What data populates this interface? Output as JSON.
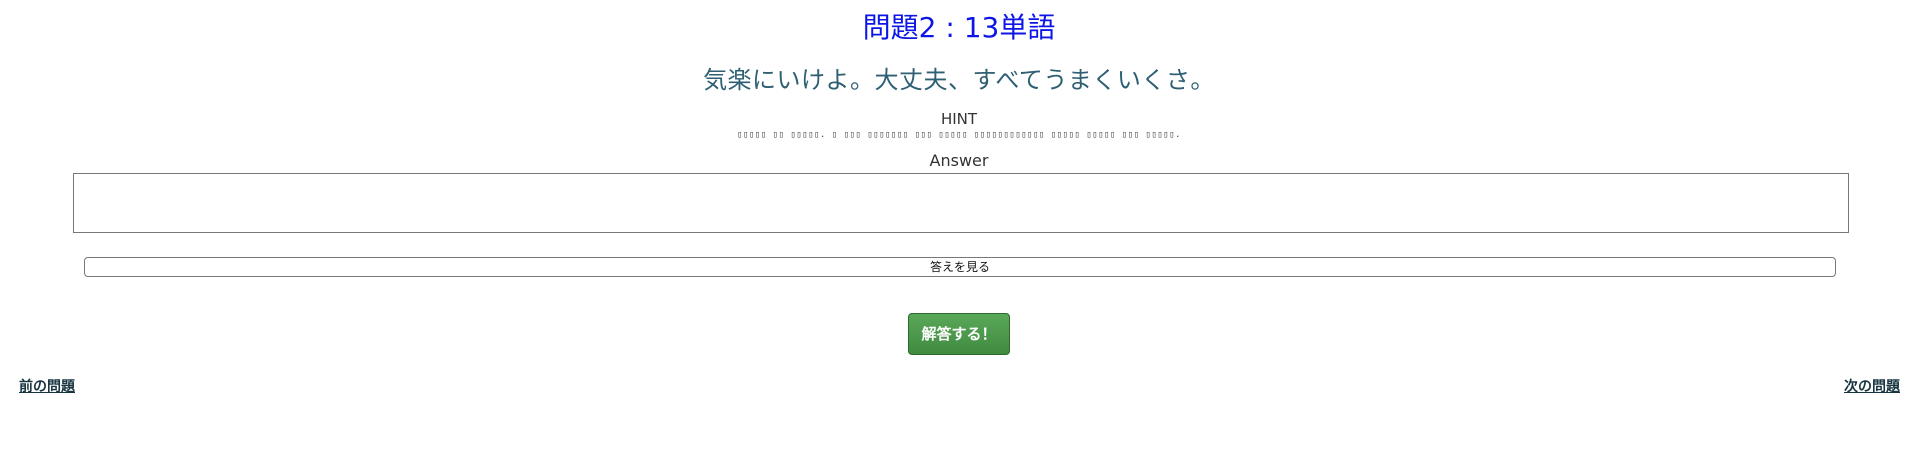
{
  "question": {
    "title": "問題2 : 13単語",
    "sentence": "気楽にいけよ。大丈夫、すべてうまくいくさ。",
    "hint_label": "HINT",
    "hint_text": "▯▯▯▯▯ ▯▯ ▯▯▯▯▯. ▯ ▯▯▯ ▯▯▯▯▯▯▯ ▯▯▯ ▯▯▯▯▯ ▯▯▯▯▯▯▯▯▯▯▯▯ ▯▯▯▯▯ ▯▯▯▯▯ ▯▯▯ ▯▯▯▯▯."
  },
  "answer": {
    "label": "Answer",
    "value": ""
  },
  "buttons": {
    "show_answer": "答えを見る",
    "submit": "解答する！"
  },
  "nav": {
    "prev": "前の問題",
    "next": "次の問題"
  },
  "colors": {
    "title": "#0d16e6",
    "sentence": "#2f5f73",
    "submit_bg": "#4a9a4a",
    "link": "#17343f"
  }
}
